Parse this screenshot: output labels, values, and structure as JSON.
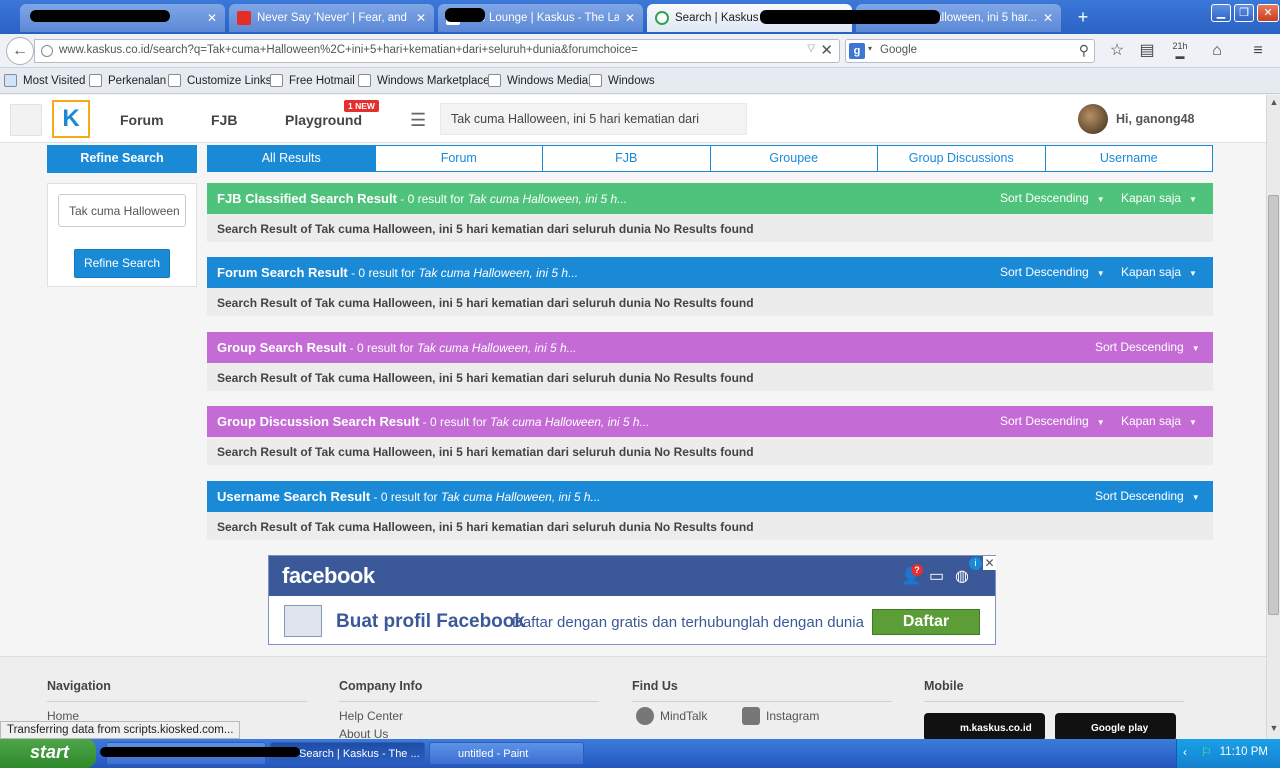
{
  "browser": {
    "tabs": [
      {
        "title": "",
        "active": false
      },
      {
        "title": "Never Say 'Never' | Fear, and",
        "active": false
      },
      {
        "title": "The Lounge | Kaskus - The La...",
        "active": false
      },
      {
        "title": "Search | Kaskus - Th...",
        "active": true
      },
      {
        "title": "alloween, ini 5 har...",
        "active": false
      }
    ],
    "url": "www.kaskus.co.id/search?q=Tak+cuma+Halloween%2C+ini+5+hari+kematian+dari+seluruh+dunia&forumchoice=",
    "search_engine": "Google",
    "download_badge": "21h",
    "bookmarks": [
      "Most Visited",
      "Perkenalan",
      "Customize Links",
      "Free Hotmail",
      "Windows Marketplace",
      "Windows Media",
      "Windows"
    ]
  },
  "header": {
    "nav": [
      "Forum",
      "FJB",
      "Playground"
    ],
    "new_badge": "1 NEW",
    "search_value": "Tak cuma Halloween, ini 5 hari kematian dari",
    "greeting": "Hi, ganong48"
  },
  "refine": {
    "title": "Refine Search",
    "input_value": "Tak cuma Halloween",
    "button": "Refine Search"
  },
  "result_tabs": [
    "All Results",
    "Forum",
    "FJB",
    "Groupee",
    "Group Discussions",
    "Username"
  ],
  "sections": [
    {
      "title": "FJB Classified Search Result",
      "count": " - 0 result for ",
      "query": "Tak cuma Halloween, ini 5 h...",
      "sort": "Sort Descending",
      "time": "Kapan saja",
      "body": "Search Result of Tak cuma Halloween, ini 5 hari kematian dari seluruh dunia No Results found",
      "color": "#4fc27b"
    },
    {
      "title": "Forum Search Result",
      "count": " - 0 result for ",
      "query": "Tak cuma Halloween, ini 5 h...",
      "sort": "Sort Descending",
      "time": "Kapan saja",
      "body": "Search Result of Tak cuma Halloween, ini 5 hari kematian dari seluruh dunia No Results found",
      "color": "#1a8ad6"
    },
    {
      "title": "Group Search Result",
      "count": " - 0 result for ",
      "query": "Tak cuma Halloween, ini 5 h...",
      "sort": "Sort Descending",
      "time": "",
      "body": "Search Result of Tak cuma Halloween, ini 5 hari kematian dari seluruh dunia No Results found",
      "color": "#c46bd6"
    },
    {
      "title": "Group Discussion Search Result",
      "count": " - 0 result for ",
      "query": "Tak cuma Halloween, ini 5 h...",
      "sort": "Sort Descending",
      "time": "Kapan saja",
      "body": "Search Result of Tak cuma Halloween, ini 5 hari kematian dari seluruh dunia No Results found",
      "color": "#c46bd6"
    },
    {
      "title": "Username Search Result",
      "count": " - 0 result for ",
      "query": "Tak cuma Halloween, ini 5 h...",
      "sort": "Sort Descending",
      "time": "",
      "body": "Search Result of Tak cuma Halloween, ini 5 hari kematian dari seluruh dunia No Results found",
      "color": "#1a8ad6"
    }
  ],
  "ad": {
    "brand": "facebook",
    "notif": "?",
    "headline": "Buat profil Facebook",
    "sub": "Daftar dengan gratis dan terhubunglah dengan dunia",
    "button": "Daftar"
  },
  "footer": {
    "navigation": {
      "title": "Navigation",
      "links": [
        "Home"
      ]
    },
    "company": {
      "title": "Company Info",
      "links": [
        "Help Center",
        "About Us"
      ]
    },
    "find_us": {
      "title": "Find Us",
      "links": [
        "MindTalk",
        "Instagram"
      ]
    },
    "mobile": {
      "title": "Mobile",
      "badges": [
        "m.kaskus.co.id",
        "Google play"
      ]
    }
  },
  "status": "Transferring data from scripts.kiosked.com...",
  "taskbar": {
    "start": "start",
    "tasks": [
      "",
      "Search | Kaskus - The ...",
      "untitled - Paint"
    ],
    "clock": "11:10 PM"
  }
}
